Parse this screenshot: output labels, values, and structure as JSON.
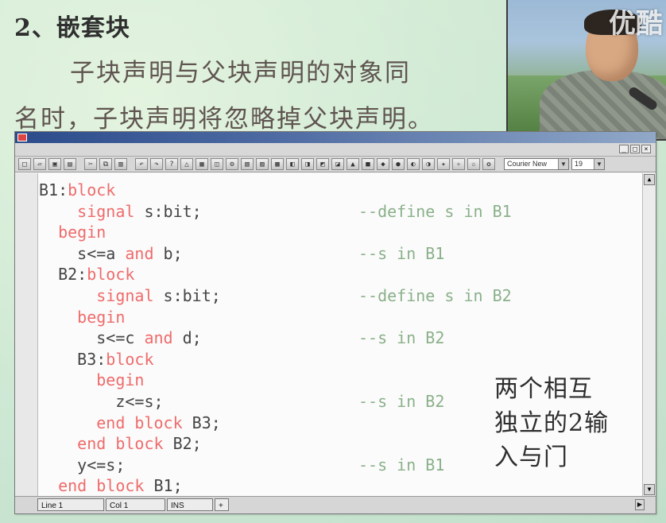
{
  "slide": {
    "heading": "2、嵌套块",
    "text_line_1": "子块声明与父块声明的对象同",
    "text_line_2": "名时，子块声明将忽略掉父块声明。",
    "annotation": "两个相互\n独立的2输\n入与门"
  },
  "watermark": "优酷",
  "editor": {
    "statusbar": {
      "line_label": "Line   1",
      "col_label": "Col   1",
      "ins_label": "INS",
      "extra": "+"
    },
    "toolbar": {
      "font_name": "Courier New",
      "font_size": "19"
    },
    "code_lines": [
      {
        "id": "l0",
        "indent": "",
        "parts": [
          {
            "t": "B1:",
            "k": false
          },
          {
            "t": "block",
            "k": true
          }
        ],
        "comment": ""
      },
      {
        "id": "l1",
        "indent": "    ",
        "parts": [
          {
            "t": "signal",
            "k": true
          },
          {
            "t": " s:bit;",
            "k": false
          }
        ],
        "comment": "--define s in B1"
      },
      {
        "id": "l2",
        "indent": "  ",
        "parts": [
          {
            "t": "begin",
            "k": true
          }
        ],
        "comment": ""
      },
      {
        "id": "l3",
        "indent": "    ",
        "parts": [
          {
            "t": "s<=a ",
            "k": false
          },
          {
            "t": "and",
            "k": true
          },
          {
            "t": " b;",
            "k": false
          }
        ],
        "comment": "--s in B1"
      },
      {
        "id": "l4",
        "indent": "  ",
        "parts": [
          {
            "t": "B2:",
            "k": false
          },
          {
            "t": "block",
            "k": true
          }
        ],
        "comment": ""
      },
      {
        "id": "l5",
        "indent": "      ",
        "parts": [
          {
            "t": "signal",
            "k": true
          },
          {
            "t": " s:bit;",
            "k": false
          }
        ],
        "comment": "--define s in B2"
      },
      {
        "id": "l6",
        "indent": "    ",
        "parts": [
          {
            "t": "begin",
            "k": true
          }
        ],
        "comment": ""
      },
      {
        "id": "l7",
        "indent": "      ",
        "parts": [
          {
            "t": "s<=c ",
            "k": false
          },
          {
            "t": "and",
            "k": true
          },
          {
            "t": " d;",
            "k": false
          }
        ],
        "comment": "--s in B2"
      },
      {
        "id": "l8",
        "indent": "    ",
        "parts": [
          {
            "t": "B3:",
            "k": false
          },
          {
            "t": "block",
            "k": true
          }
        ],
        "comment": ""
      },
      {
        "id": "l9",
        "indent": "      ",
        "parts": [
          {
            "t": "begin",
            "k": true
          }
        ],
        "comment": ""
      },
      {
        "id": "l10",
        "indent": "        ",
        "parts": [
          {
            "t": "z<=s;",
            "k": false
          }
        ],
        "comment": "--s in B2"
      },
      {
        "id": "l11",
        "indent": "      ",
        "parts": [
          {
            "t": "end block",
            "k": true
          },
          {
            "t": " B3;",
            "k": false
          }
        ],
        "comment": ""
      },
      {
        "id": "l12",
        "indent": "    ",
        "parts": [
          {
            "t": "end block",
            "k": true
          },
          {
            "t": " B2;",
            "k": false
          }
        ],
        "comment": ""
      },
      {
        "id": "l13",
        "indent": "    ",
        "parts": [
          {
            "t": "y<=s;",
            "k": false
          }
        ],
        "comment": "--s in B1"
      },
      {
        "id": "l14",
        "indent": "  ",
        "parts": [
          {
            "t": "end block",
            "k": true
          },
          {
            "t": " B1;",
            "k": false
          }
        ],
        "comment": ""
      }
    ]
  },
  "colors": {
    "keyword": "#ef6b6b",
    "comment": "#8ab08a",
    "code": "#444444",
    "slide_background": "#c9e4cf"
  },
  "icons": [
    "new-file-icon",
    "open-folder-icon",
    "save-icon",
    "print-icon",
    "cut-icon",
    "copy-icon",
    "paste-icon",
    "undo-icon",
    "redo-icon",
    "help-icon",
    "warning-icon",
    "compile-icon",
    "simulate-icon",
    "settings-icon"
  ]
}
